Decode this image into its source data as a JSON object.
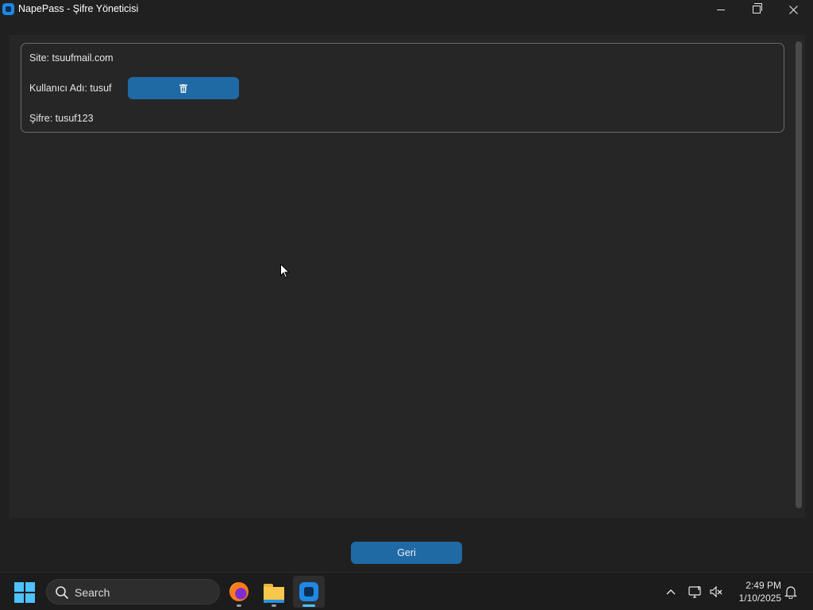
{
  "window": {
    "title": "NapePass - Şifre Yöneticisi"
  },
  "entry": {
    "site_text": "Site: tsuufmail.com",
    "user_text": "Kullanıcı Adı: tusuf",
    "password_text": "Şifre: tusuf123",
    "delete_icon": "trash-icon"
  },
  "footer": {
    "back_label": "Geri"
  },
  "taskbar": {
    "search_placeholder": "Search",
    "apps": [
      "firefox-icon",
      "file-explorer-icon",
      "napepass-icon"
    ],
    "time": "2:49 PM",
    "date": "1/10/2025"
  },
  "colors": {
    "background": "#202020",
    "panel": "#262626",
    "accent_button": "#1f6aa5",
    "border": "#6b6b6b"
  }
}
